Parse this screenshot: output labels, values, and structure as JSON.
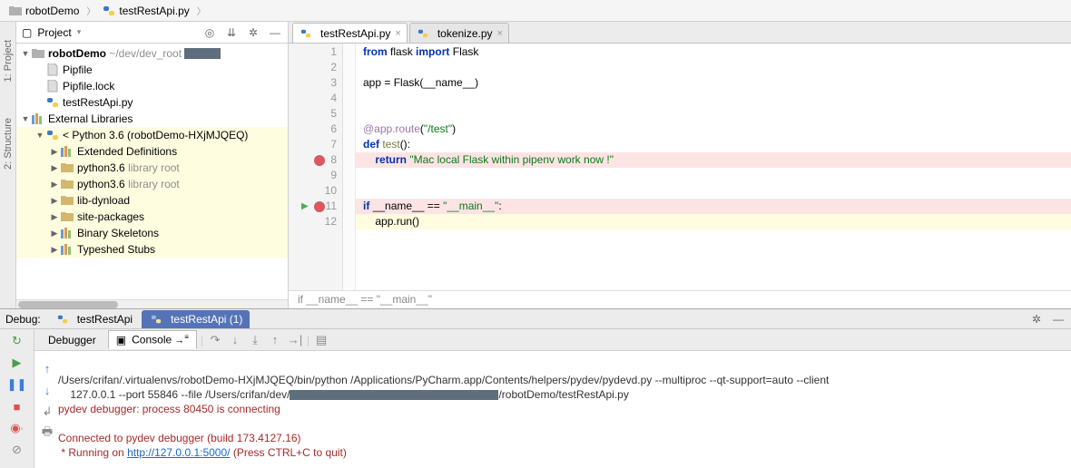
{
  "breadcrumb": {
    "root": "robotDemo",
    "file": "testRestApi.py"
  },
  "sidebar_tabs": [
    "1: Project",
    "2: Structure"
  ],
  "project": {
    "header": "Project",
    "root_name": "robotDemo",
    "root_path": "~/dev/dev_root",
    "files": [
      "Pipfile",
      "Pipfile.lock",
      "testRestApi.py"
    ],
    "ext_lib": "External Libraries",
    "python_env": "< Python 3.6 (robotDemo-HXjMJQEQ)",
    "lib_nodes": [
      "Extended Definitions",
      "python3.6",
      "python3.6",
      "lib-dynload",
      "site-packages",
      "Binary Skeletons",
      "Typeshed Stubs"
    ],
    "library_root_suffix": "library root"
  },
  "editor": {
    "tabs": [
      {
        "name": "testRestApi.py",
        "active": true
      },
      {
        "name": "tokenize.py",
        "active": false
      }
    ],
    "lines": [
      1,
      2,
      3,
      4,
      5,
      6,
      7,
      8,
      9,
      10,
      11,
      12
    ],
    "code": {
      "from": "from",
      "flask": "flask",
      "import": "import",
      "Flask": "Flask",
      "app_assign": "app = Flask(__name__)",
      "decorator": "@app.route",
      "route_arg": "\"/test\"",
      "def": "def",
      "fn_name": "test",
      "return": "return",
      "ret_str": "\"Mac local Flask within pipenv work now !\"",
      "if": "if",
      "main_cond": "__name__ == ",
      "main_str": "\"__main__\"",
      "colon": ":",
      "run_call": "app.run()"
    },
    "breadcrumb_bottom": "if __name__ == \"__main__\""
  },
  "debug": {
    "label": "Debug:",
    "tab1": "testRestApi",
    "tab2": "testRestApi (1)",
    "tool_debugger": "Debugger",
    "tool_console": "Console",
    "console": {
      "line1a": "/Users/crifan/.virtualenvs/robotDemo-HXjMJQEQ/bin/python /Applications/PyCharm.app/Contents/helpers/pydev/pydevd.py --multiproc --qt-support=auto --client",
      "line1b_prefix": "    127.0.0.1 --port 55846 --file /Users/crifan/dev/",
      "line1b_suffix": "/robotDemo/testRestApi.py",
      "line2": "pydev debugger: process 80450 is connecting",
      "line3": "",
      "line4": "Connected to pydev debugger (build 173.4127.16)",
      "line5_prefix": " * Running on ",
      "line5_link": "http://127.0.0.1:5000/",
      "line5_suffix": " (Press CTRL+C to quit)"
    }
  }
}
